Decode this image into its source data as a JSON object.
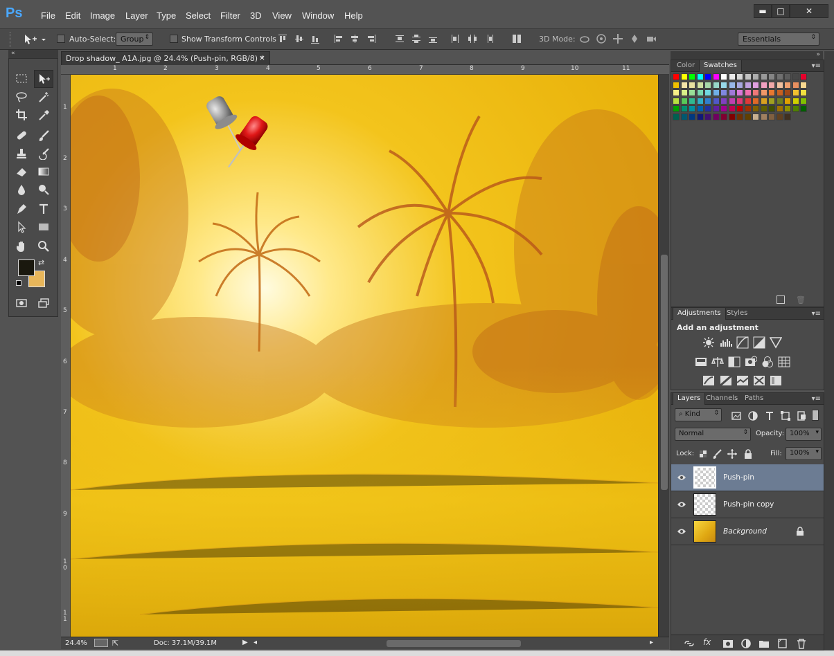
{
  "app": {
    "logo": "Ps"
  },
  "menu": [
    "File",
    "Edit",
    "Image",
    "Layer",
    "Type",
    "Select",
    "Filter",
    "3D",
    "View",
    "Window",
    "Help"
  ],
  "window_controls": {
    "minimize": "▬",
    "maximize": "□",
    "close": "✕"
  },
  "options_bar": {
    "auto_select_label": "Auto-Select:",
    "auto_select_value": "Group",
    "show_transform_label": "Show Transform Controls",
    "mode_3d_label": "3D Mode:",
    "workspace": "Essentials"
  },
  "document": {
    "tab_title": "Drop shadow_ A1A.jpg @ 24.4% (Push-pin, RGB/8) *",
    "tab_close": "×",
    "ruler_top": [
      "1",
      "2",
      "3",
      "4",
      "5",
      "6",
      "7",
      "8",
      "9",
      "10",
      "11"
    ],
    "ruler_left": [
      "1",
      "2",
      "3",
      "4",
      "5",
      "6",
      "7",
      "8",
      "9",
      "1 0",
      "1 1"
    ],
    "zoom": "24.4%",
    "doc_size": "Doc: 37.1M/39.1M"
  },
  "swatches_panel": {
    "tabs": [
      "Color",
      "Swatches"
    ],
    "active_tab": "Swatches",
    "colors": [
      "#ff0000",
      "#ffff00",
      "#00ff00",
      "#00ffff",
      "#0000ff",
      "#ff00ff",
      "#ffffff",
      "#ebebeb",
      "#d6d6d6",
      "#c2c2c2",
      "#adadad",
      "#999999",
      "#858585",
      "#707070",
      "#5c5c5c",
      "#474747",
      "#e8002c",
      "#f0c000",
      "#f4e4a8",
      "#e8e0a0",
      "#d0e0a0",
      "#a8d8a8",
      "#98d8c8",
      "#98d8e8",
      "#98b8e8",
      "#a8a8e0",
      "#c0a0e0",
      "#e0a0e0",
      "#f0a0c0",
      "#f0a8a8",
      "#f0c0a0",
      "#f0a070",
      "#e89060",
      "#f8d890",
      "#f8f088",
      "#d8f088",
      "#98e098",
      "#78d8b0",
      "#70d8e0",
      "#70b0e8",
      "#8088e0",
      "#a078d8",
      "#d878d8",
      "#f070b0",
      "#f07878",
      "#f09868",
      "#e87830",
      "#c86020",
      "#a04818",
      "#f0c030",
      "#f0e040",
      "#b8e040",
      "#58c858",
      "#30b890",
      "#30b0c8",
      "#3080d0",
      "#5058c8",
      "#8040c0",
      "#c040b0",
      "#e03878",
      "#e03838",
      "#e06828",
      "#d8a020",
      "#a0a020",
      "#708020",
      "#e0a000",
      "#d0d000",
      "#80c000",
      "#00a000",
      "#009070",
      "#0090a0",
      "#0060b0",
      "#2030a0",
      "#6020a0",
      "#a00090",
      "#c00050",
      "#c00000",
      "#a03000",
      "#806000",
      "#606000",
      "#405000",
      "#a07000",
      "#909000",
      "#508000",
      "#006000",
      "#006050",
      "#005870",
      "#003880",
      "#101878",
      "#401070",
      "#700060",
      "#800030",
      "#800000",
      "#703000",
      "#604000",
      "#c8b090",
      "#a08060",
      "#806040",
      "#604020",
      "#403020"
    ]
  },
  "adjustments_panel": {
    "tabs": [
      "Adjustments",
      "Styles"
    ],
    "active_tab": "Adjustments",
    "heading": "Add an adjustment",
    "icons": [
      "brightness-icon",
      "levels-icon",
      "curves-icon",
      "exposure-icon",
      "vibrance-icon",
      "hue-saturation-icon",
      "color-balance-icon",
      "black-white-icon",
      "photo-filter-icon",
      "channel-mixer-icon",
      "color-lookup-icon",
      "invert-icon",
      "posterize-icon",
      "threshold-icon",
      "gradient-map-icon",
      "selective-color-icon"
    ]
  },
  "layers_panel": {
    "tabs": [
      "Layers",
      "Channels",
      "Paths"
    ],
    "active_tab": "Layers",
    "filter_kind": "Kind",
    "blend_mode": "Normal",
    "opacity_label": "Opacity:",
    "opacity_value": "100%",
    "lock_label": "Lock:",
    "fill_label": "Fill:",
    "fill_value": "100%",
    "layers": [
      {
        "name": "Push-pin",
        "selected": true
      },
      {
        "name": "Push-pin copy",
        "selected": false
      },
      {
        "name": "Background",
        "selected": false,
        "locked": true
      }
    ]
  }
}
